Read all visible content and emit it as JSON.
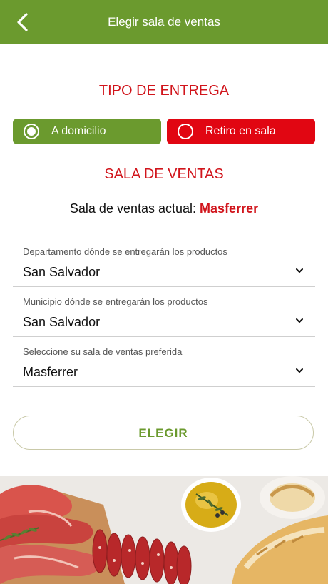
{
  "header": {
    "title": "Elegir sala de ventas",
    "back_icon": "chevron-left-icon"
  },
  "delivery": {
    "section_title": "TIPO DE ENTREGA",
    "options": [
      {
        "label": "A domicilio",
        "selected": true,
        "color": "#6b9a2e"
      },
      {
        "label": "Retiro en sala",
        "selected": false,
        "color": "#d1151c"
      }
    ]
  },
  "sales": {
    "section_title": "SALA DE VENTAS",
    "current_label": "Sala de ventas actual:",
    "current_value": "Masferrer"
  },
  "fields": [
    {
      "hint": "Departamento dónde se entregarán los productos",
      "value": "San Salvador"
    },
    {
      "hint": "Municipio dónde se entregarán los productos",
      "value": "San Salvador"
    },
    {
      "hint": "Seleccione su sala de ventas preferida",
      "value": "Masferrer"
    }
  ],
  "button": {
    "label": "ELEGIR"
  },
  "colors": {
    "brand_green": "#6b9a2e",
    "brand_red": "#d1151c"
  }
}
